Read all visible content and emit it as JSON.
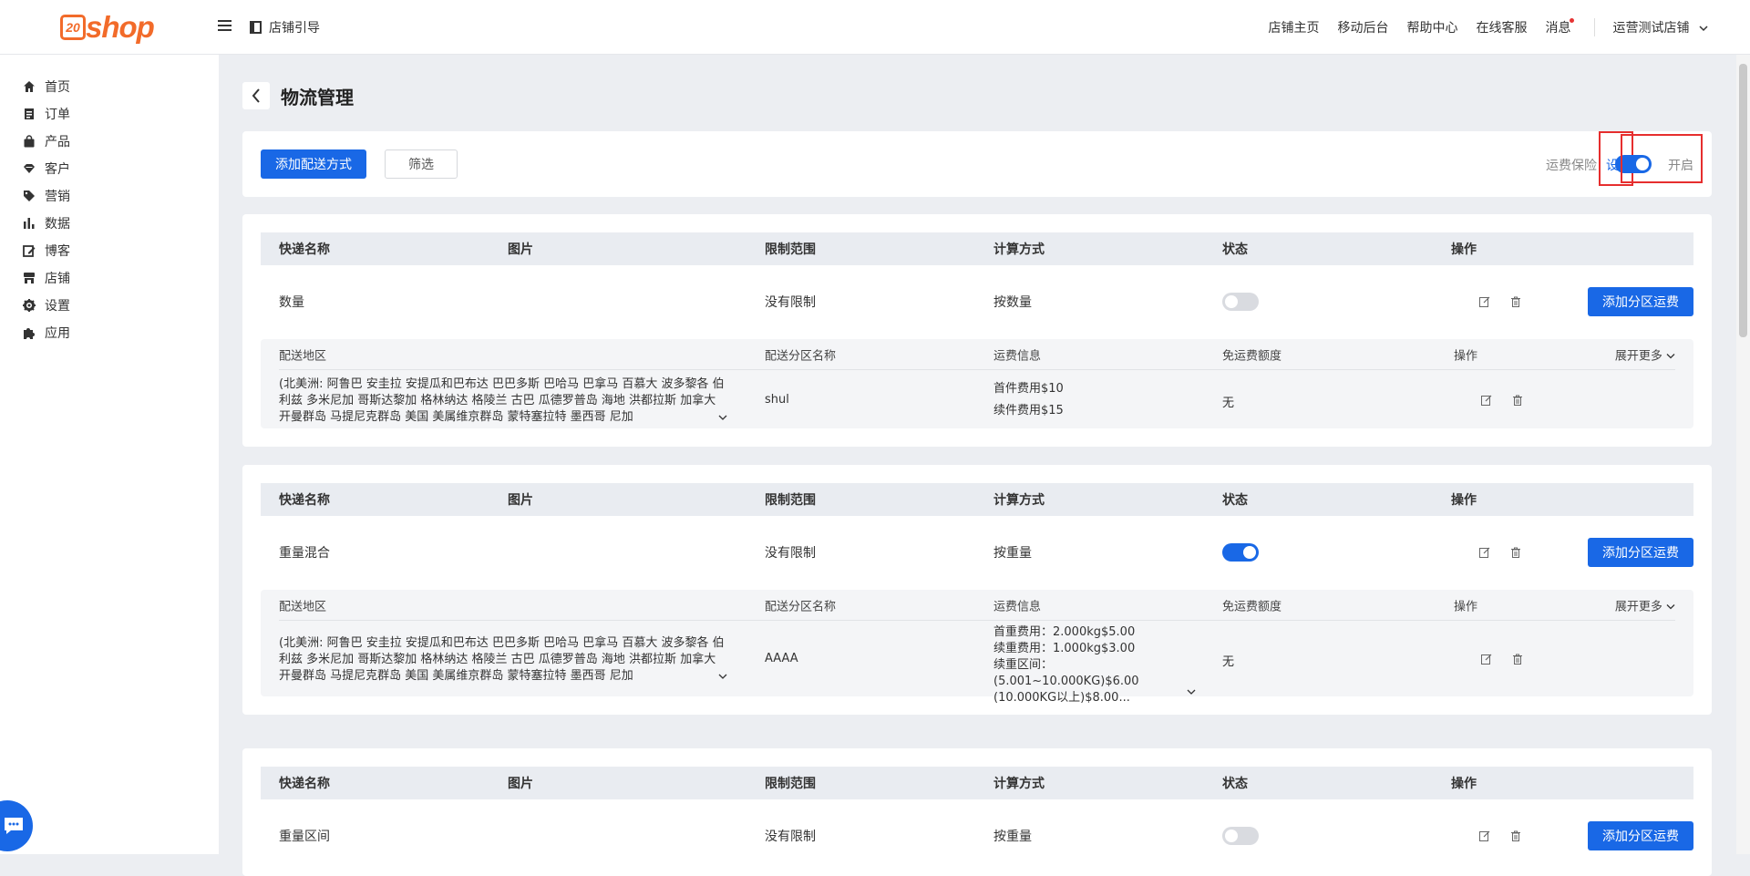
{
  "header": {
    "logo_prefix": "20",
    "logo_text": "shop",
    "guide_label": "店铺引导",
    "nav": [
      "店铺主页",
      "移动后台",
      "帮助中心",
      "在线客服",
      "消息"
    ],
    "store_name": "运营测试店铺"
  },
  "sidebar": {
    "items": [
      {
        "label": "首页",
        "icon": "home-icon"
      },
      {
        "label": "订单",
        "icon": "order-icon"
      },
      {
        "label": "产品",
        "icon": "product-bag-icon"
      },
      {
        "label": "客户",
        "icon": "customer-diamond-icon"
      },
      {
        "label": "营销",
        "icon": "tag-icon"
      },
      {
        "label": "数据",
        "icon": "bar-chart-icon"
      },
      {
        "label": "博客",
        "icon": "edit-icon"
      },
      {
        "label": "店铺",
        "icon": "store-icon"
      },
      {
        "label": "设置",
        "icon": "gear-icon"
      },
      {
        "label": "应用",
        "icon": "puzzle-icon"
      }
    ]
  },
  "page": {
    "title": "物流管理",
    "add_button": "添加配送方式",
    "filter_button": "筛选",
    "insurance_label": "运费保险",
    "insurance_set": "设置",
    "insurance_status": "开启"
  },
  "table": {
    "headers": [
      "快递名称",
      "图片",
      "限制范围",
      "计算方式",
      "状态",
      "操作"
    ],
    "sub_headers": [
      "配送地区",
      "配送分区名称",
      "运费信息",
      "免运费额度",
      "操作"
    ],
    "expand_label": "展开更多",
    "add_zone_button": "添加分区运费"
  },
  "methods": [
    {
      "name": "数量",
      "limit": "没有限制",
      "calc": "按数量",
      "enabled": false,
      "zone": {
        "region": "(北美洲: 阿鲁巴 安圭拉 安提瓜和巴布达 巴巴多斯 巴哈马 巴拿马 百慕大 波多黎各 伯利兹 多米尼加 哥斯达黎加 格林纳达 格陵兰 古巴 瓜德罗普岛 海地 洪都拉斯 加拿大 开曼群岛 马提尼克群岛 美国 美属维京群岛 蒙特塞拉特 墨西哥 尼加",
        "zone_name": "shul",
        "fees": [
          "首件费用$10",
          "续件费用$15"
        ],
        "free_quota": "无"
      }
    },
    {
      "name": "重量混合",
      "limit": "没有限制",
      "calc": "按重量",
      "enabled": true,
      "zone": {
        "region": "(北美洲: 阿鲁巴 安圭拉 安提瓜和巴布达 巴巴多斯 巴哈马 巴拿马 百慕大 波多黎各 伯利兹 多米尼加 哥斯达黎加 格林纳达 格陵兰 古巴 瓜德罗普岛 海地 洪都拉斯 加拿大 开曼群岛 马提尼克群岛 美国 美属维京群岛 蒙特塞拉特 墨西哥 尼加",
        "zone_name": "AAAA",
        "fees": [
          "首重费用：2.000kg$5.00",
          "续重费用：1.000kg$3.00",
          "续重区间：",
          "(5.001~10.000KG)$6.00",
          "(10.000KG以上)$8.00..."
        ],
        "free_quota": "无"
      }
    },
    {
      "name": "重量区间",
      "limit": "没有限制",
      "calc": "按重量",
      "enabled": false
    }
  ]
}
